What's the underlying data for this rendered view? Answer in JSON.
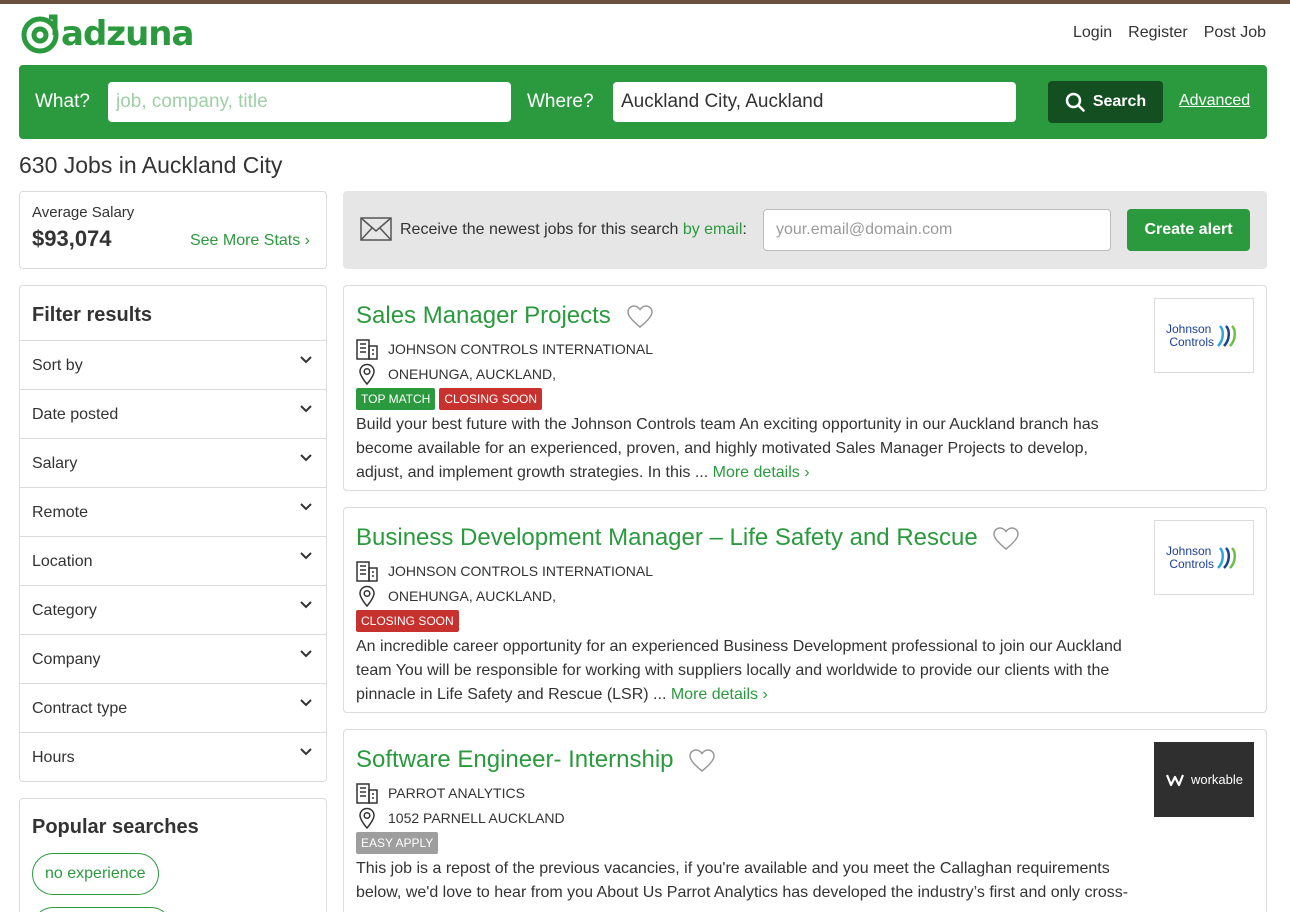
{
  "brand": {
    "name": "adzuna",
    "color": "#2b9a3e"
  },
  "topnav": {
    "login": "Login",
    "register": "Register",
    "post_job": "Post Job"
  },
  "search": {
    "what_label": "What?",
    "what_placeholder": "job, company, title",
    "where_label": "Where?",
    "where_value": "Auckland City, Auckland",
    "button": "Search",
    "advanced": "Advanced"
  },
  "results_title": "630 Jobs in Auckland City",
  "salary": {
    "label": "Average Salary",
    "value": "$93,074",
    "link": "See More Stats ›"
  },
  "filters": {
    "title": "Filter results",
    "items": [
      "Sort by",
      "Date posted",
      "Salary",
      "Remote",
      "Location",
      "Category",
      "Company",
      "Contract type",
      "Hours"
    ]
  },
  "popular": {
    "title": "Popular searches",
    "items": [
      "no experience"
    ]
  },
  "alert": {
    "text": "Receive the newest jobs for this search",
    "link": "by email",
    "colon": ":",
    "placeholder": "your.email@domain.com",
    "button": "Create alert"
  },
  "jobs": [
    {
      "title": "Sales Manager Projects",
      "company": "JOHNSON CONTROLS INTERNATIONAL",
      "location": "ONEHUNGA, AUCKLAND,",
      "badges": [
        "TOP MATCH",
        "CLOSING SOON"
      ],
      "description": "Build your best future with the Johnson Controls team An exciting opportunity in our Auckland branch has become available for an experienced, proven, and highly motivated Sales Manager Projects to develop, adjust, and implement growth strategies. In this ...",
      "more": "More details ›",
      "logo_line1": "Johnson",
      "logo_line2": "Controls"
    },
    {
      "title": "Business Development Manager – Life Safety and Rescue",
      "company": "JOHNSON CONTROLS INTERNATIONAL",
      "location": "ONEHUNGA, AUCKLAND,",
      "badges": [
        "CLOSING SOON"
      ],
      "description": "An incredible career opportunity for an experienced Business Development professional to join our Auckland team You will be responsible for working with suppliers locally and worldwide to provide our clients with the pinnacle in Life Safety and Rescue (LSR) ...",
      "more": "More details ›",
      "logo_line1": "Johnson",
      "logo_line2": "Controls"
    },
    {
      "title": "Software Engineer- Internship",
      "company": "PARROT ANALYTICS",
      "location": "1052 PARNELL AUCKLAND",
      "badges": [
        "EASY APPLY"
      ],
      "description": "This job is a repost of the previous vacancies, if you're available and you meet the Callaghan requirements below, we'd love to hear from you About Us Parrot Analytics has developed the industry’s first and only cross-",
      "logo_text": "workable"
    }
  ]
}
